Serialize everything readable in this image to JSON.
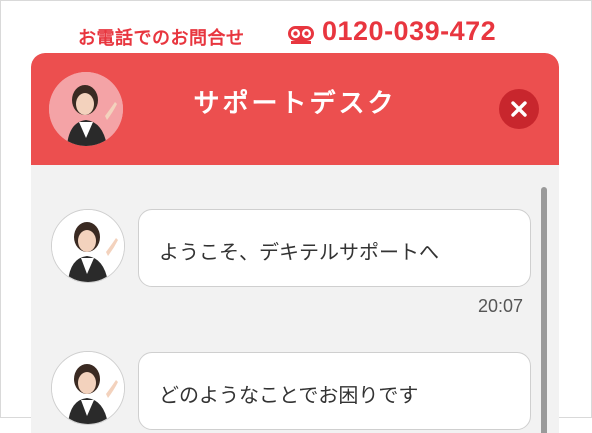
{
  "contact": {
    "tel_label": "お電話でのお問合せ",
    "phone_icon": "freedial-icon",
    "tel_number": "0120-039-472",
    "accent_color": "#e8363f"
  },
  "chat_window": {
    "title": "サポートデスク",
    "header_color": "#ec4f4f",
    "close_icon": "close-icon",
    "close_button_color": "#c8262d"
  },
  "messages": [
    {
      "text": "ようこそ、デキテルサポートへ",
      "time": "20:07"
    },
    {
      "text": "どのようなことでお困りです",
      "time": ""
    }
  ]
}
